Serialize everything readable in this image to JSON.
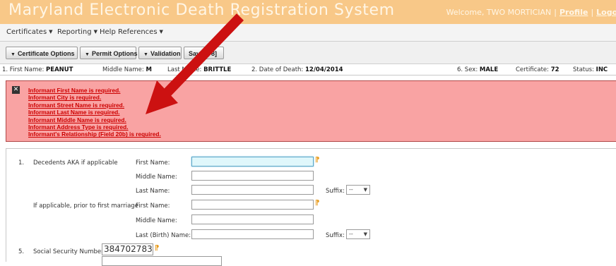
{
  "banner": {
    "title": "Maryland Electronic Death Registration System",
    "welcome_text": "Welcome, TWO MORTICIAN",
    "separator": "|",
    "profile_link": "Profile",
    "logout_link": "Logou"
  },
  "menu": {
    "items": [
      "Certificates",
      "Reporting",
      "Help References"
    ]
  },
  "toolbar": {
    "certificate_options": "Certificate Options",
    "permit_options": "Permit Options",
    "validation": "Validation",
    "save_label": "Save [F8]"
  },
  "infobar": {
    "first_name_label": "1. First Name:",
    "first_name_value": "PEANUT",
    "middle_name_label": "Middle Name:",
    "middle_name_value": "M",
    "last_name_label": "Last Name:",
    "last_name_value": "BRITTLE",
    "date_of_death_label": "2. Date of Death:",
    "date_of_death_value": "12/04/2014",
    "sex_label": "6. Sex:",
    "sex_value": "MALE",
    "certificate_label": "Certificate:",
    "certificate_value": "72",
    "status_label": "Status:",
    "status_value": "INC"
  },
  "errors": [
    "Informant First Name is required.",
    "Informant City is required.",
    "Informant Street Name is required.",
    "Informant Last Name is required.",
    "Informant Middle Name is required.",
    "Informant Address Type is required.",
    "Informant's Relationship (Field 20b) is required."
  ],
  "form": {
    "item1_number": "1.",
    "item1_label": "Decedents AKA if applicable",
    "first_name_label": "First Name:",
    "middle_name_label": "Middle Name:",
    "last_name_label": "Last Name:",
    "suffix_label": "Suffix:",
    "suffix_value": "--",
    "prior_marriage_label": "If applicable, prior to first marriage",
    "prior_first_name_label": "First Name:",
    "prior_middle_name_label": "Middle Name:",
    "last_birth_name_label": "Last (Birth) Name:",
    "suffix2_label": "Suffix:",
    "suffix2_value": "--",
    "item5_number": "5.",
    "ssn_label": "Social Security Number",
    "ssn_value": "384702783"
  },
  "colors": {
    "banner": "#f8c888",
    "error_background": "#f9a3a3",
    "error_text": "#cc0000",
    "arrow": "#cc1111",
    "required_marker": "#e89a1a"
  }
}
